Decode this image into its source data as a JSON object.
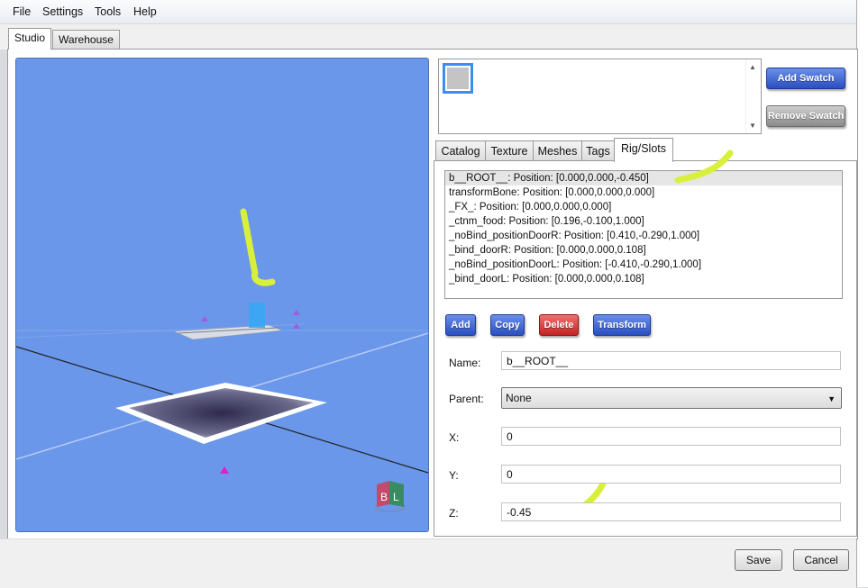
{
  "menu": [
    "File",
    "Settings",
    "Tools",
    "Help"
  ],
  "top_tabs": [
    "Studio",
    "Warehouse"
  ],
  "swatch": {
    "add_label": "Add Swatch",
    "remove_label": "Remove Swatch",
    "color": "#c4c4c4"
  },
  "panel_tabs": [
    "Catalog",
    "Texture",
    "Meshes",
    "Tags",
    "Rig/Slots"
  ],
  "active_panel_tab": "Rig/Slots",
  "bones": [
    "b__ROOT__: Position: [0.000,0.000,-0.450]",
    "transformBone: Position: [0.000,0.000,0.000]",
    "_FX_: Position: [0.000,0.000,0.000]",
    "_ctnm_food: Position: [0.196,-0.100,1.000]",
    "_noBind_positionDoorR: Position: [0.410,-0.290,1.000]",
    "_bind_doorR: Position: [0.000,0.000,0.108]",
    "_noBind_positionDoorL: Position: [-0.410,-0.290,1.000]",
    "_bind_doorL: Position: [0.000,0.000,0.108]"
  ],
  "actions": {
    "add": "Add",
    "copy": "Copy",
    "delete": "Delete",
    "transform": "Transform"
  },
  "form": {
    "name_label": "Name:",
    "name_value": "b__ROOT__",
    "parent_label": "Parent:",
    "parent_value": "None",
    "x_label": "X:",
    "x_value": "0",
    "y_label": "Y:",
    "y_value": "0",
    "z_label": "Z:",
    "z_value": "-0.45"
  },
  "footer": {
    "save": "Save",
    "cancel": "Cancel"
  },
  "colors": {
    "viewport": "#6a97ea",
    "annotation": "#d8f03a",
    "accent": "#2a4fc0"
  }
}
